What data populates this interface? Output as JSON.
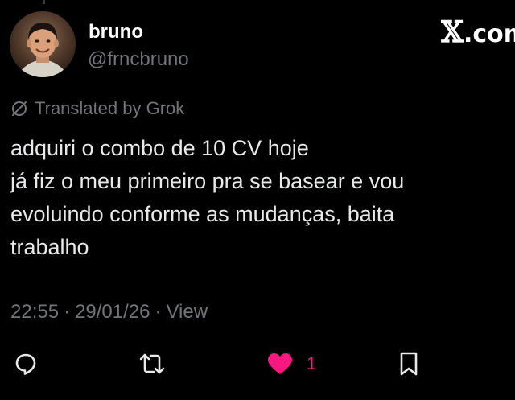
{
  "author": {
    "display_name": "bruno",
    "handle": "@frncbruno"
  },
  "brand": {
    "mark": "𝕏",
    "rest": ".com"
  },
  "translation": {
    "label": "Translated by Grok",
    "icon": "translate-slash-icon"
  },
  "tweet": {
    "lines": [
      "adquiri o combo de 10 CV hoje",
      "já fiz o meu primeiro pra se basear e vou",
      "evoluindo conforme as mudanças, baita",
      "trabalho"
    ]
  },
  "meta": {
    "time": "22:55",
    "separator": "·",
    "date": "29/01/26",
    "view_label": "View"
  },
  "actions": {
    "reply_icon": "reply-icon",
    "retweet_icon": "retweet-icon",
    "like_icon": "heart-icon",
    "like_count": "1",
    "bookmark_icon": "bookmark-icon"
  },
  "colors": {
    "background": "#000000",
    "text_primary": "#e7e9ea",
    "text_secondary": "#71767b",
    "like": "#f91880"
  }
}
